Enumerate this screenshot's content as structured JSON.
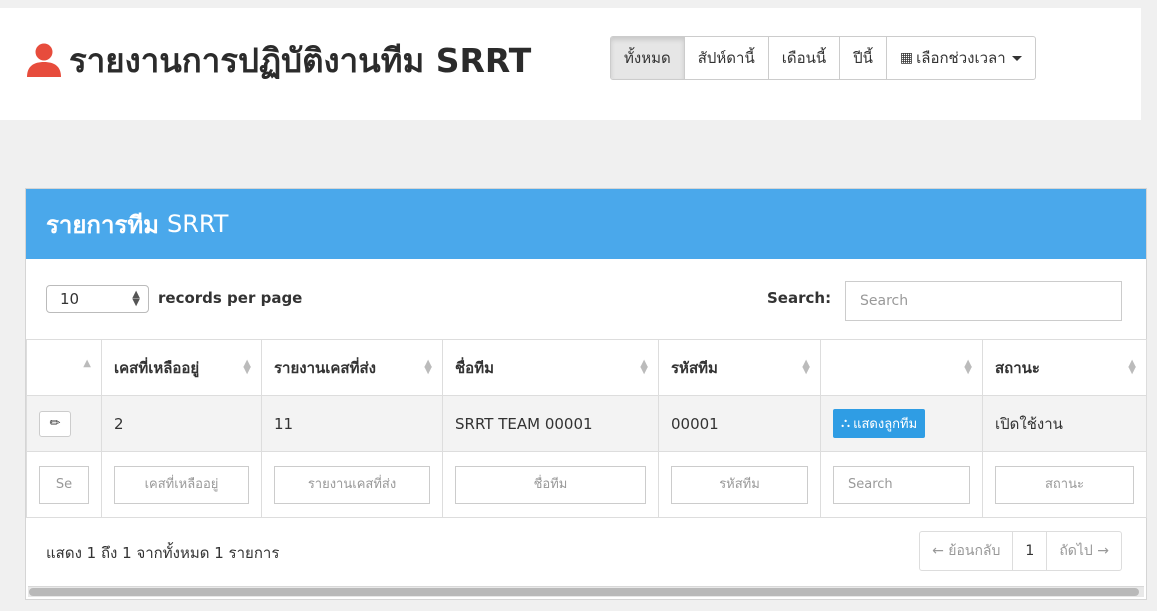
{
  "header": {
    "title": "รายงานการปฏิบัติงานทีม SRRT",
    "title_icon": "user-icon",
    "ranges": [
      {
        "label": "ทั้งหมด",
        "active": true
      },
      {
        "label": "สัปห์ดานี้",
        "active": false
      },
      {
        "label": "เดือนนี้",
        "active": false
      },
      {
        "label": "ปีนี้",
        "active": false
      }
    ],
    "custom_range": {
      "label": "เลือกช่วงเวลา",
      "icon": "calendar-icon"
    }
  },
  "card": {
    "title_bold": "รายการทีม",
    "title_rest": "SRRT",
    "header_color": "#4aa8eb"
  },
  "controls": {
    "per_page_value": "10",
    "per_page_label": "records per page",
    "search_label": "Search:",
    "search_placeholder": "Search"
  },
  "table": {
    "columns": [
      "",
      "เคสที่เหลืออยู่",
      "รายงานเคสที่ส่ง",
      "ชื่อทีม",
      "รหัสทีม",
      "",
      "สถานะ"
    ],
    "rows": [
      {
        "remaining": "2",
        "reported": "11",
        "team_name": "SRRT TEAM 00001",
        "team_code": "00001",
        "action_label": "แสดงลูกทีม",
        "status": "เปิดใช้งาน"
      }
    ],
    "filters": [
      "Se",
      "เคสที่เหลืออยู่",
      "รายงานเคสที่ส่ง",
      "ชื่อทีม",
      "รหัสทีม",
      "Search",
      "สถานะ"
    ]
  },
  "footer": {
    "info": "แสดง 1 ถึง 1 จากทั้งหมด 1 รายการ",
    "prev_label": "← ย้อนกลับ",
    "current_page": "1",
    "next_label": "ถัดไป →"
  },
  "colors": {
    "accent": "#4aa8eb",
    "button_blue": "#2f9de4",
    "icon_red": "#e74c3c"
  }
}
